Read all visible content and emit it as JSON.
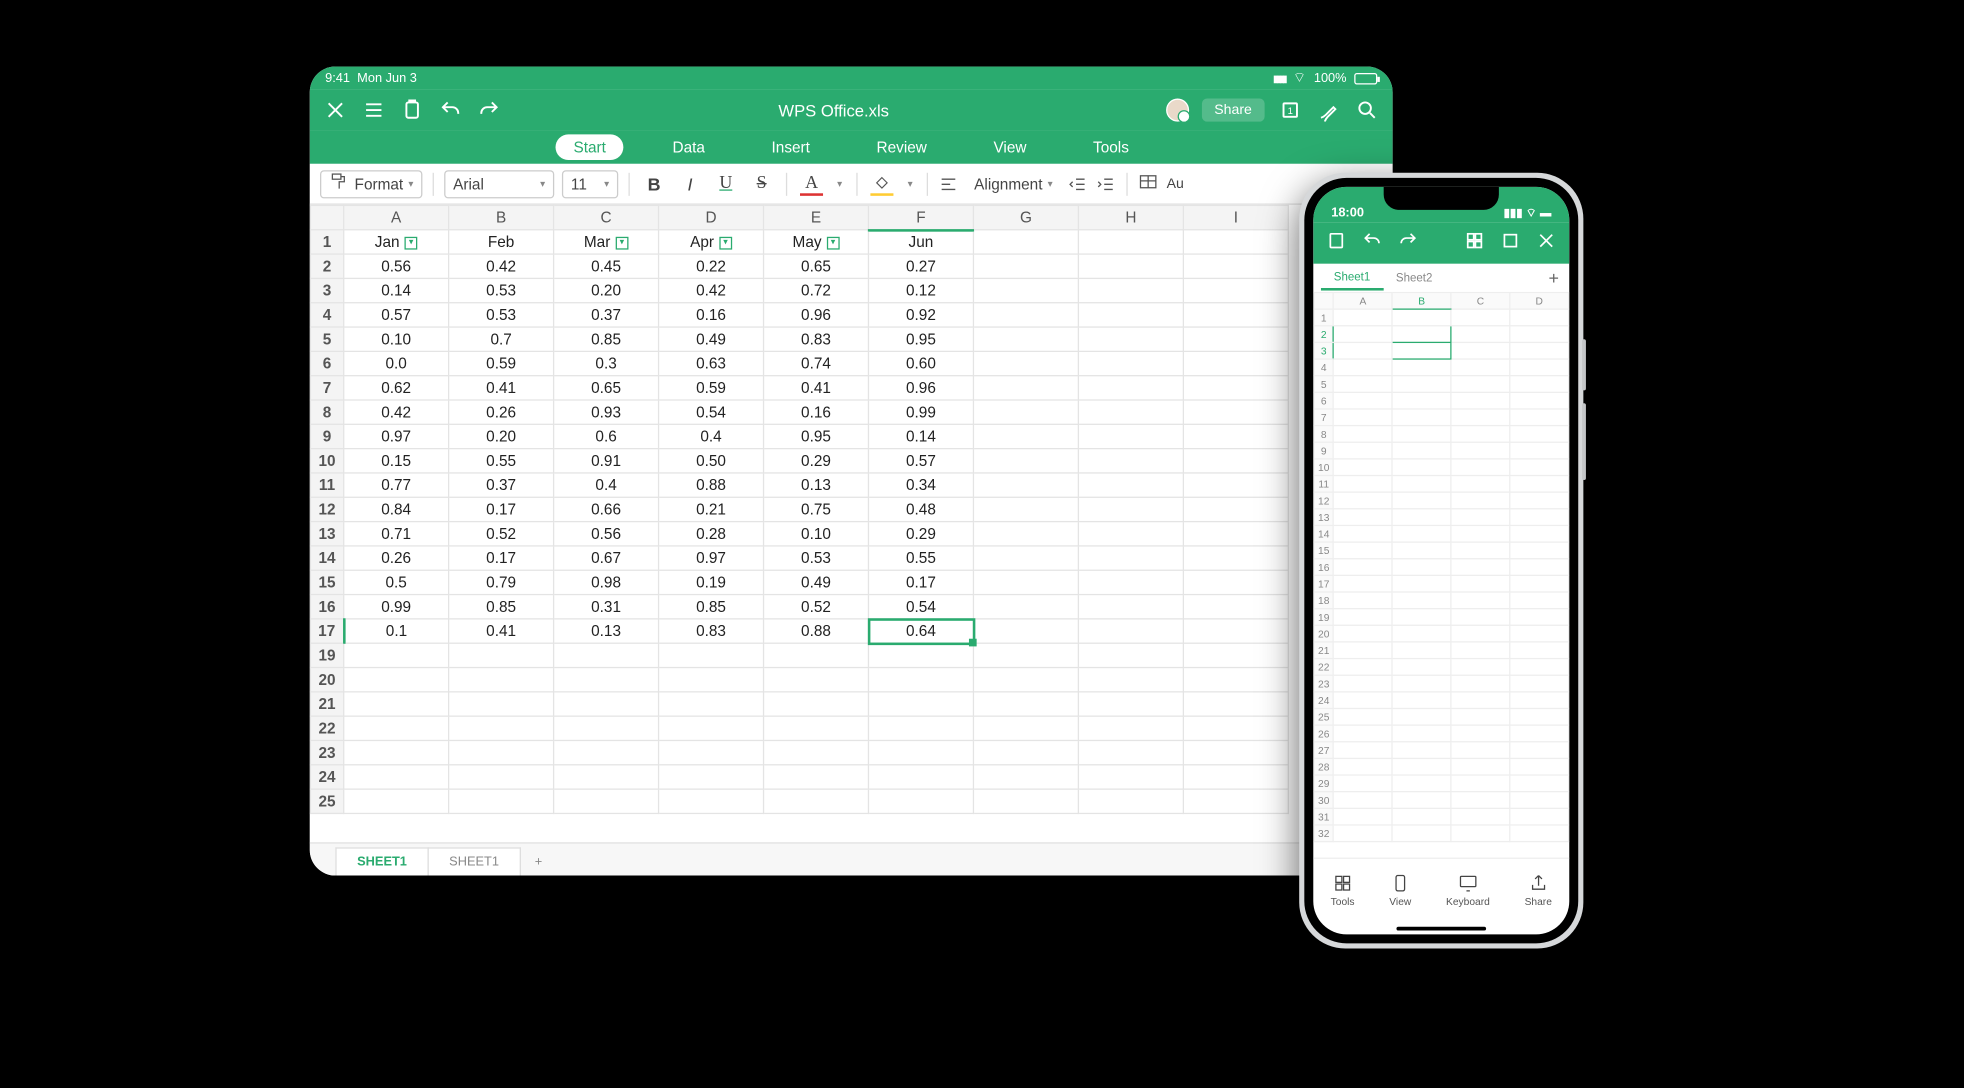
{
  "tablet": {
    "status": {
      "time": "9:41",
      "date": "Mon Jun 3",
      "battery": "100%"
    },
    "filename": "WPS Office.xls",
    "share_label": "Share",
    "ribbon": [
      "Start",
      "Data",
      "Insert",
      "Review",
      "View",
      "Tools"
    ],
    "active_ribbon": 0,
    "toolbar": {
      "format": "Format",
      "font": "Arial",
      "size": "11",
      "alignment": "Alignment",
      "auto": "Au"
    },
    "columns": [
      "A",
      "B",
      "C",
      "D",
      "E",
      "F",
      "G",
      "H",
      "I"
    ],
    "month_headers": [
      "Jan",
      "Feb",
      "Mar",
      "Apr",
      "May",
      "Jun"
    ],
    "filter_cols": [
      0,
      2,
      3,
      4
    ],
    "data_rows": [
      [
        "0.56",
        "0.42",
        "0.45",
        "0.22",
        "0.65",
        "0.27"
      ],
      [
        "0.14",
        "0.53",
        "0.20",
        "0.42",
        "0.72",
        "0.12"
      ],
      [
        "0.57",
        "0.53",
        "0.37",
        "0.16",
        "0.96",
        "0.92"
      ],
      [
        "0.10",
        "0.7",
        "0.85",
        "0.49",
        "0.83",
        "0.95"
      ],
      [
        "0.0",
        "0.59",
        "0.3",
        "0.63",
        "0.74",
        "0.60"
      ],
      [
        "0.62",
        "0.41",
        "0.65",
        "0.59",
        "0.41",
        "0.96"
      ],
      [
        "0.42",
        "0.26",
        "0.93",
        "0.54",
        "0.16",
        "0.99"
      ],
      [
        "0.97",
        "0.20",
        "0.6",
        "0.4",
        "0.95",
        "0.14"
      ],
      [
        "0.15",
        "0.55",
        "0.91",
        "0.50",
        "0.29",
        "0.57"
      ],
      [
        "0.77",
        "0.37",
        "0.4",
        "0.88",
        "0.13",
        "0.34"
      ],
      [
        "0.84",
        "0.17",
        "0.66",
        "0.21",
        "0.75",
        "0.48"
      ],
      [
        "0.71",
        "0.52",
        "0.56",
        "0.28",
        "0.10",
        "0.29"
      ],
      [
        "0.26",
        "0.17",
        "0.67",
        "0.97",
        "0.53",
        "0.55"
      ],
      [
        "0.5",
        "0.79",
        "0.98",
        "0.19",
        "0.49",
        "0.17"
      ],
      [
        "0.99",
        "0.85",
        "0.31",
        "0.85",
        "0.52",
        "0.54"
      ],
      [
        "0.1",
        "0.41",
        "0.13",
        "0.83",
        "0.88",
        "0.64"
      ]
    ],
    "selected_cell": {
      "row": 17,
      "col": 5
    },
    "empty_rows": [
      19,
      20,
      21,
      22,
      23,
      24,
      25
    ],
    "sheets": [
      "SHEET1",
      "SHEET1"
    ],
    "active_sheet": 0
  },
  "phone": {
    "time": "18:00",
    "tabs": [
      "Sheet1",
      "Sheet2"
    ],
    "active_tab": 0,
    "columns": [
      "A",
      "B",
      "C",
      "D"
    ],
    "rows": 32,
    "selected": {
      "rows": [
        2,
        3
      ],
      "col": "B"
    },
    "bottom": [
      {
        "label": "Tools",
        "icon": "grid"
      },
      {
        "label": "View",
        "icon": "phone"
      },
      {
        "label": "Keyboard",
        "icon": "keyboard"
      },
      {
        "label": "Share",
        "icon": "share"
      }
    ]
  }
}
